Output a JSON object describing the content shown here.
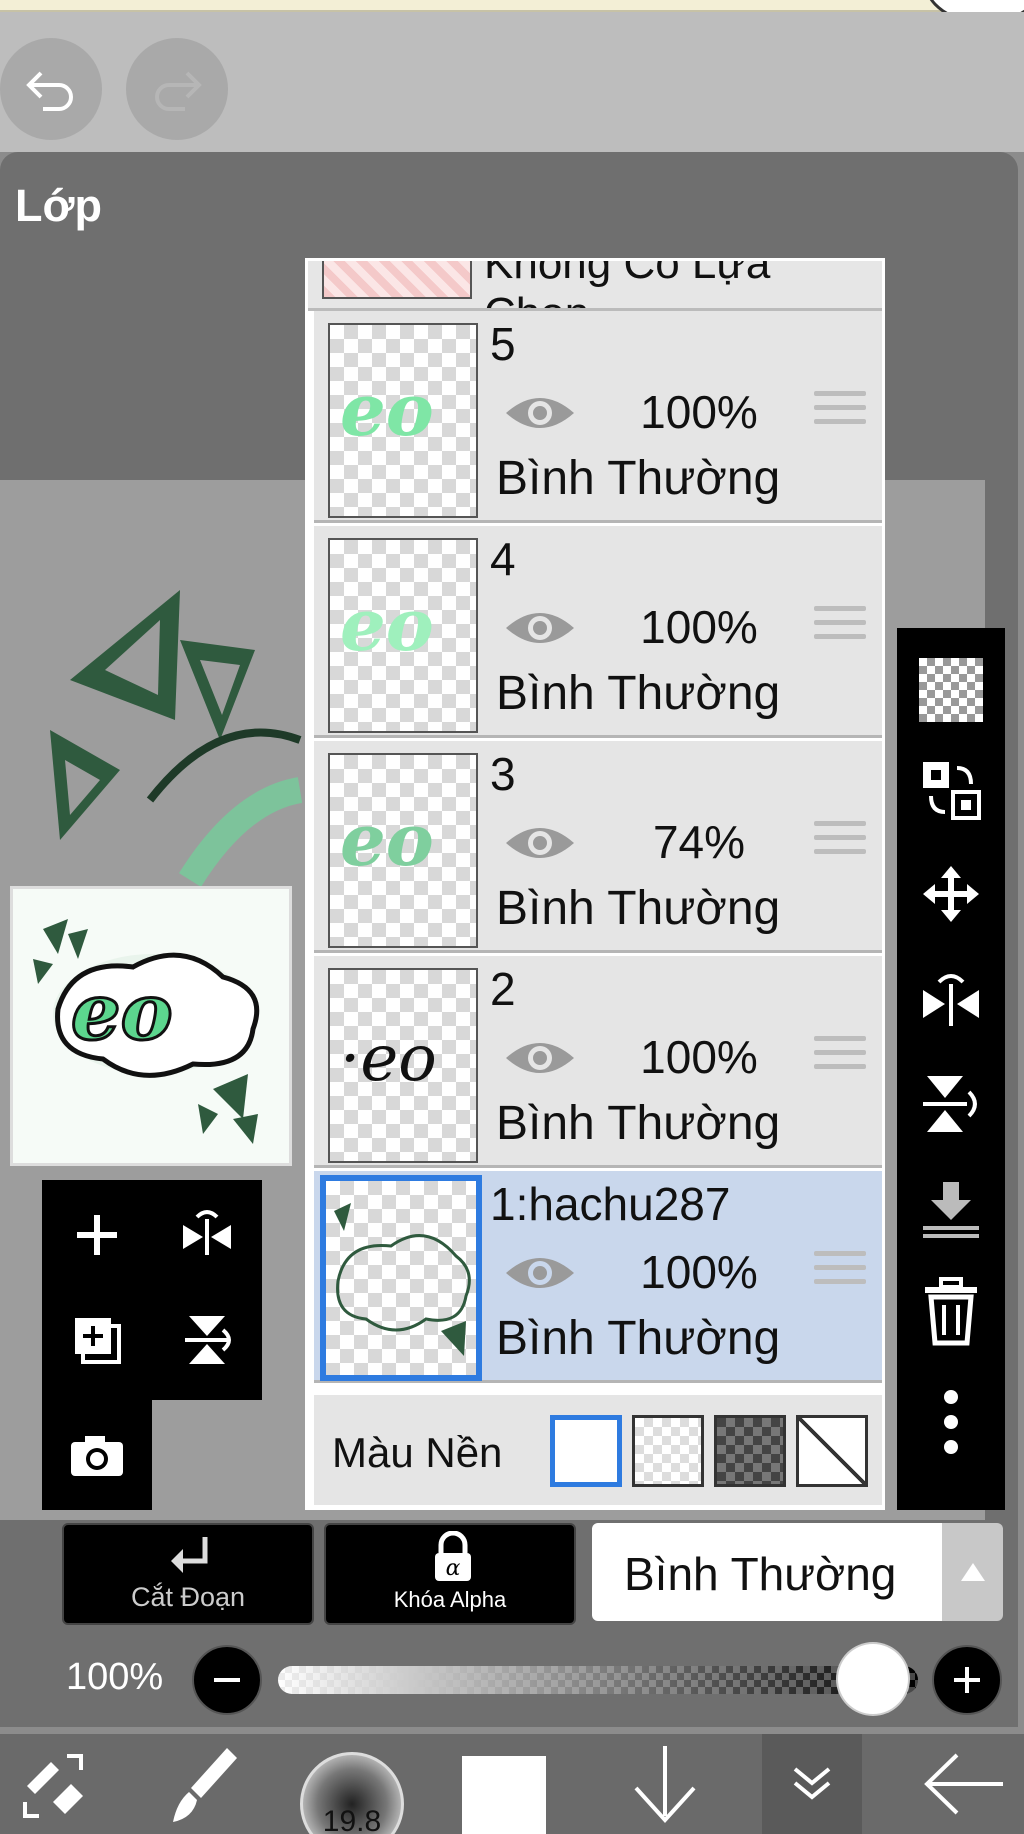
{
  "header": {
    "undo_icon": "undo-icon",
    "redo_icon": "redo-icon"
  },
  "panel": {
    "title": "Lớp"
  },
  "layers": {
    "selection_layer_label": "Không Có Lựa Chọn",
    "items": [
      {
        "name": "5",
        "opacity": "100%",
        "mode": "Bình Thường",
        "visible": true,
        "selected": false
      },
      {
        "name": "4",
        "opacity": "100%",
        "mode": "Bình Thường",
        "visible": true,
        "selected": false
      },
      {
        "name": "3",
        "opacity": "74%",
        "mode": "Bình Thường",
        "visible": true,
        "selected": false
      },
      {
        "name": "2",
        "opacity": "100%",
        "mode": "Bình Thường",
        "visible": true,
        "selected": false
      },
      {
        "name": "1:hachu287",
        "opacity": "100%",
        "mode": "Bình Thường",
        "visible": true,
        "selected": true
      }
    ],
    "background_label": "Màu Nền",
    "background_options": [
      "white",
      "transparent-light",
      "transparent-dark",
      "none"
    ],
    "selected_background": "white"
  },
  "right_toolbar": [
    "transparency-icon",
    "swap-layer-icon",
    "move-icon",
    "flip-horizontal-icon",
    "flip-vertical-icon",
    "merge-down-icon",
    "trash-icon",
    "more-icon"
  ],
  "left_tools": [
    "add-layer-icon",
    "rotate-flip-icon",
    "add-copy-icon",
    "flip-vertical-icon",
    "camera-icon"
  ],
  "controls": {
    "clip_label": "Cắt Đoạn",
    "alpha_lock_label": "Khóa Alpha",
    "blend_mode": "Bình Thường",
    "opacity_label": "100%",
    "opacity_value": 1.0
  },
  "bottom_bar": {
    "brush_size": "19.8",
    "color": "#ffffff"
  },
  "colors": {
    "accent": "#2e7be0",
    "selected_row": "#c9d7ec",
    "panel": "#6f6f6f",
    "toolbar": "#000000"
  }
}
